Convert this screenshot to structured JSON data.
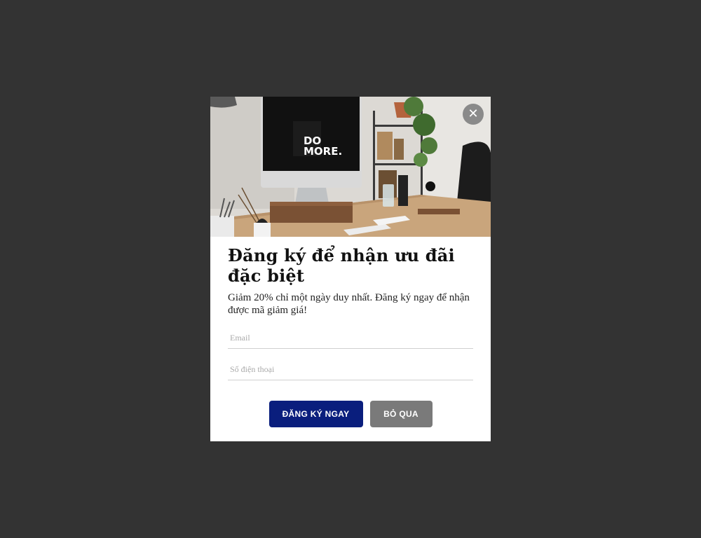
{
  "colors": {
    "overlay": "#333333",
    "modal_bg": "#ffffff",
    "primary_button": "#0a1e7d",
    "secondary_button": "#7a7a7a",
    "close_button": "#8a8a8a"
  },
  "hero": {
    "screen_text_line1": "DO",
    "screen_text_line2": "MORE."
  },
  "close": {
    "icon": "close-icon",
    "glyph": "✕"
  },
  "popup": {
    "title": "Đăng ký để nhận ưu đãi đặc biệt",
    "description": "Giảm 20% chỉ một ngày duy nhất. Đăng ký ngay để nhận được mã giảm giá!",
    "email_placeholder": "Email",
    "phone_placeholder": "Số điện thoại",
    "submit_label": "ĐĂNG KÝ NGAY",
    "skip_label": "BỎ QUA"
  }
}
